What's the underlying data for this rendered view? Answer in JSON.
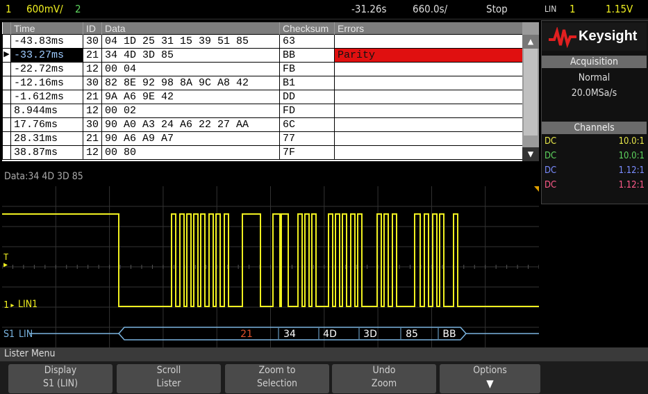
{
  "status_bar": {
    "channel_num": "1",
    "channel_scale": "600mV/",
    "channel2": "2",
    "time_offset": "-31.26s",
    "time_scale": "660.0s/",
    "run_state": "Stop",
    "trigger_source": "LIN",
    "trigger_channel": "1",
    "trigger_level": "1.15V"
  },
  "lister": {
    "columns": [
      "Time",
      "ID",
      "Data",
      "Checksum",
      "Errors"
    ],
    "rows": [
      {
        "time": "-43.83ms",
        "id": "30",
        "data": "04 1D 25 31 15 39 51 85",
        "checksum": "63",
        "errors": ""
      },
      {
        "time": "-33.27ms",
        "id": "21",
        "data": "34 4D 3D 85",
        "checksum": "BB",
        "errors": "Parity"
      },
      {
        "time": "-22.72ms",
        "id": "12",
        "data": "00 04",
        "checksum": "FB",
        "errors": ""
      },
      {
        "time": "-12.16ms",
        "id": "30",
        "data": "82 8E 92 98 8A 9C A8 42",
        "checksum": "B1",
        "errors": ""
      },
      {
        "time": "-1.612ms",
        "id": "21",
        "data": "9A A6 9E 42",
        "checksum": "DD",
        "errors": ""
      },
      {
        "time": "8.944ms",
        "id": "12",
        "data": "00 02",
        "checksum": "FD",
        "errors": ""
      },
      {
        "time": "17.76ms",
        "id": "30",
        "data": "90 A0 A3 24 A6 22 27 AA",
        "checksum": "6C",
        "errors": ""
      },
      {
        "time": "28.31ms",
        "id": "21",
        "data": "90 A6 A9 A7",
        "checksum": "77",
        "errors": ""
      },
      {
        "time": "38.87ms",
        "id": "12",
        "data": "00 80",
        "checksum": "7F",
        "errors": ""
      }
    ],
    "selected_marker": "▶",
    "scroll_up_icon": "▲",
    "scroll_down_icon": "▼"
  },
  "data_label": "Data:34 4D 3D 85",
  "brand": {
    "name": "Keysight"
  },
  "acquisition": {
    "title": "Acquisition",
    "mode": "Normal",
    "rate": "20.0MSa/s"
  },
  "channels": {
    "title": "Channels",
    "items": [
      {
        "coupling": "DC",
        "value": "10.0:1",
        "color": "#e8e84a"
      },
      {
        "coupling": "DC",
        "value": "10.0:1",
        "color": "#5ed45e"
      },
      {
        "coupling": "DC",
        "value": "1.12:1",
        "color": "#7a8cff"
      },
      {
        "coupling": "DC",
        "value": "1.12:1",
        "color": "#ff5a8a"
      }
    ]
  },
  "waveform": {
    "trigger_marker": "T",
    "channel_label": "LIN1",
    "channel_label_prefix": "1",
    "serial_label": "LIN",
    "serial_prefix": "S1",
    "decode": [
      "21",
      "34",
      "4D",
      "3D",
      "85",
      "BB"
    ]
  },
  "menu_title": "Lister Menu",
  "softkeys": [
    {
      "line1": "Display",
      "line2": "S1 (LIN)"
    },
    {
      "line1": "Scroll",
      "line2": "Lister"
    },
    {
      "line1": "Zoom to",
      "line2": "Selection"
    },
    {
      "line1": "Undo",
      "line2": "Zoom"
    },
    {
      "line1": "Options",
      "line2": ""
    }
  ],
  "colors": {
    "ch1": "#f0f020",
    "serial": "#7ab4e0",
    "error": "#e01010",
    "brand_red": "#e02020",
    "decode_error": "#e0502a"
  }
}
